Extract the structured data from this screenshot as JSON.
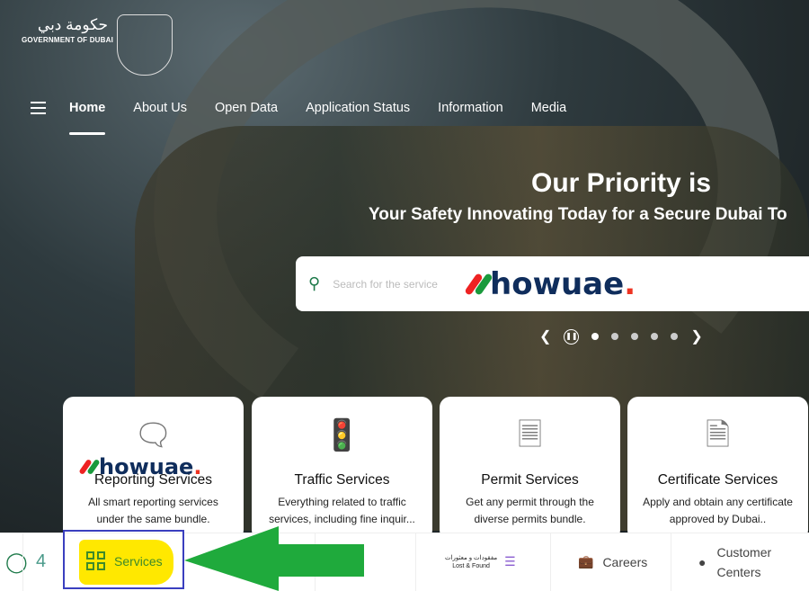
{
  "logo": {
    "arabic": "حكومة دبي",
    "english": "GOVERNMENT OF DUBAI"
  },
  "nav": {
    "menu_icon": "hamburger-icon",
    "items": [
      {
        "label": "Home",
        "active": true
      },
      {
        "label": "About Us"
      },
      {
        "label": "Open Data"
      },
      {
        "label": "Application Status"
      },
      {
        "label": "Information"
      },
      {
        "label": "Media"
      }
    ]
  },
  "hero": {
    "title": "Our Priority is",
    "subtitle": "Your Safety Innovating Today for a Secure Dubai To"
  },
  "search": {
    "placeholder": "Search for the service"
  },
  "watermark": {
    "text": "howuae",
    "dot": "."
  },
  "carousel": {
    "slides": 5,
    "active": 1
  },
  "cards": [
    {
      "title": "Reporting Services",
      "desc": "All smart reporting services under the same bundle.",
      "icon": "report-bubble-icon"
    },
    {
      "title": "Traffic Services",
      "desc": "Everything related to traffic services, including fine inquir...",
      "icon": "traffic-icon"
    },
    {
      "title": "Permit Services",
      "desc": "Get any permit through the diverse permits bundle.",
      "icon": "permit-lock-icon"
    },
    {
      "title": "Certificate Services",
      "desc": "Apply and obtain any certificate approved by Dubai..",
      "icon": "certificate-icon"
    }
  ],
  "bottom_bar": {
    "services": "Services",
    "lost_found_en": "Lost & Found",
    "lost_found_ar": "مفقودات و معثورات",
    "careers": "Careers",
    "customer_centers": "Customer Centers"
  },
  "colors": {
    "accent_green": "#1e7a4a",
    "highlight_yellow": "#ffe800",
    "annotation_blue": "#3a3fbf",
    "arrow_green": "#1faa3c",
    "brand_navy": "#0f2d5c"
  }
}
